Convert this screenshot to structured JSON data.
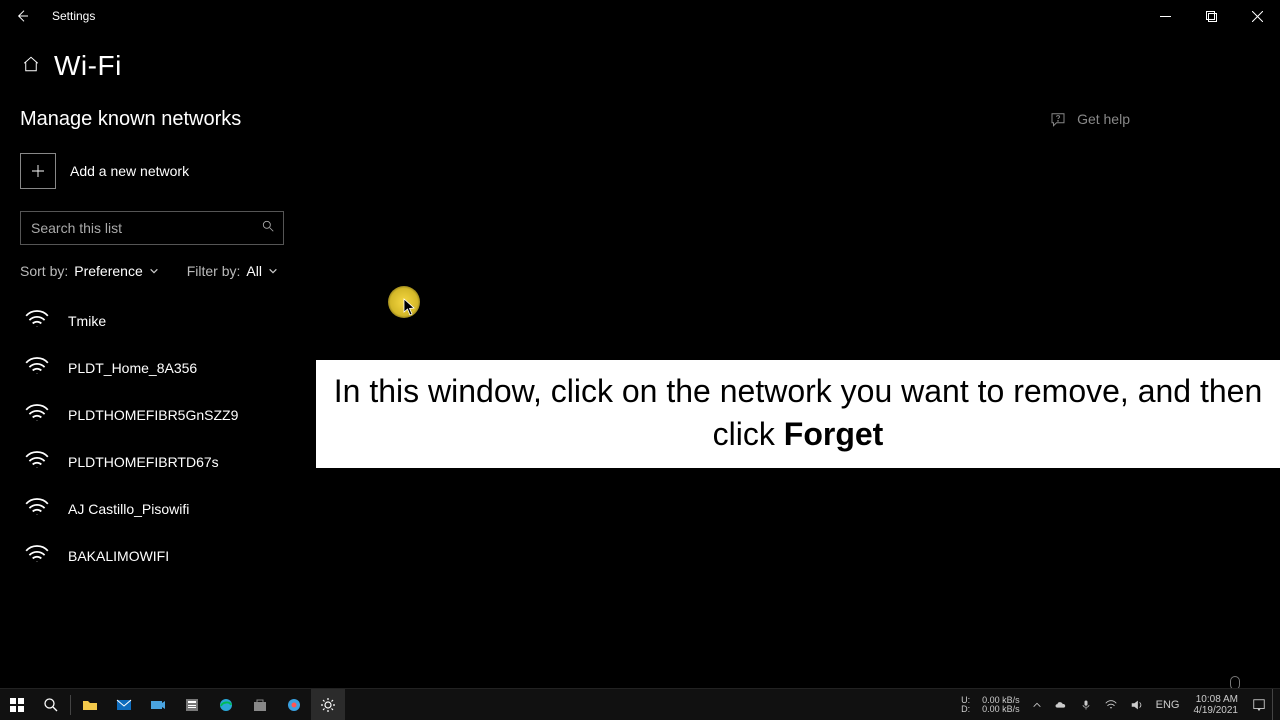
{
  "window": {
    "title": "Settings"
  },
  "header": {
    "page_title": "Wi-Fi"
  },
  "section": {
    "heading": "Manage known networks",
    "add_label": "Add a new network",
    "search_placeholder": "Search this list",
    "sort_label": "Sort by:",
    "sort_value": "Preference",
    "filter_label": "Filter by:",
    "filter_value": "All"
  },
  "networks": [
    {
      "name": "Tmike"
    },
    {
      "name": "PLDT_Home_8A356"
    },
    {
      "name": "PLDTHOMEFIBR5GnSZZ9"
    },
    {
      "name": "PLDTHOMEFIBRTD67s"
    },
    {
      "name": "AJ Castillo_Pisowifi"
    },
    {
      "name": "BAKALIMOWIFI"
    }
  ],
  "help": {
    "label": "Get help"
  },
  "instruction": {
    "text_before": "In this window, click on the network you want to remove, and then click ",
    "text_bold": "Forget"
  },
  "taskbar": {
    "net_up_label": "U:",
    "net_down_label": "D:",
    "net_up": "0.00 kB/s",
    "net_down": "0.00 kB/s",
    "lang": "ENG",
    "time": "10:08 AM",
    "date": "4/19/2021"
  }
}
